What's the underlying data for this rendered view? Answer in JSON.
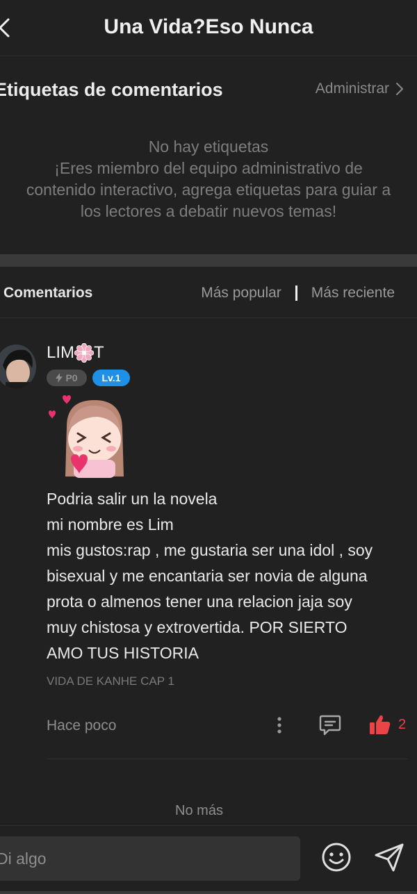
{
  "header": {
    "back_icon": "chevron-left-icon",
    "title": "Una Vida?Eso Nunca"
  },
  "tags": {
    "title": "Etiquetas de comentarios",
    "admin_label": "Administrar",
    "empty_title": "No hay etiquetas",
    "empty_lines": [
      "¡Eres miembro del equipo administrativo de",
      "contenido interactivo, agrega etiquetas para guiar a",
      "los lectores a debatir nuevos temas!"
    ]
  },
  "comments": {
    "label": "Comentarios",
    "sort_popular": "Más popular",
    "sort_recent": "Más reciente"
  },
  "comment": {
    "username_before": "LIM",
    "username_after": "T",
    "badge_points": "P0",
    "badge_level": "Lv.1",
    "body_lines": [
      "Podria salir un la novela",
      "mi nombre es Lim",
      "mis gustos:rap , me gustaria ser una idol , soy",
      "bisexual y me encantaria ser novia de alguna",
      "prota o almenos tener una relacion jaja soy",
      "muy chistosa y extrovertida. POR SIERTO",
      "AMO TUS HISTORIA"
    ],
    "chapter": "VIDA DE KANHE CAP 1",
    "time": "Hace poco",
    "likes": "2"
  },
  "footer": {
    "no_more": "No más"
  },
  "composer": {
    "placeholder": "Di algo"
  },
  "colors": {
    "background": "#212121",
    "like": "#ea4447",
    "level_badge": "#1e90e8"
  }
}
